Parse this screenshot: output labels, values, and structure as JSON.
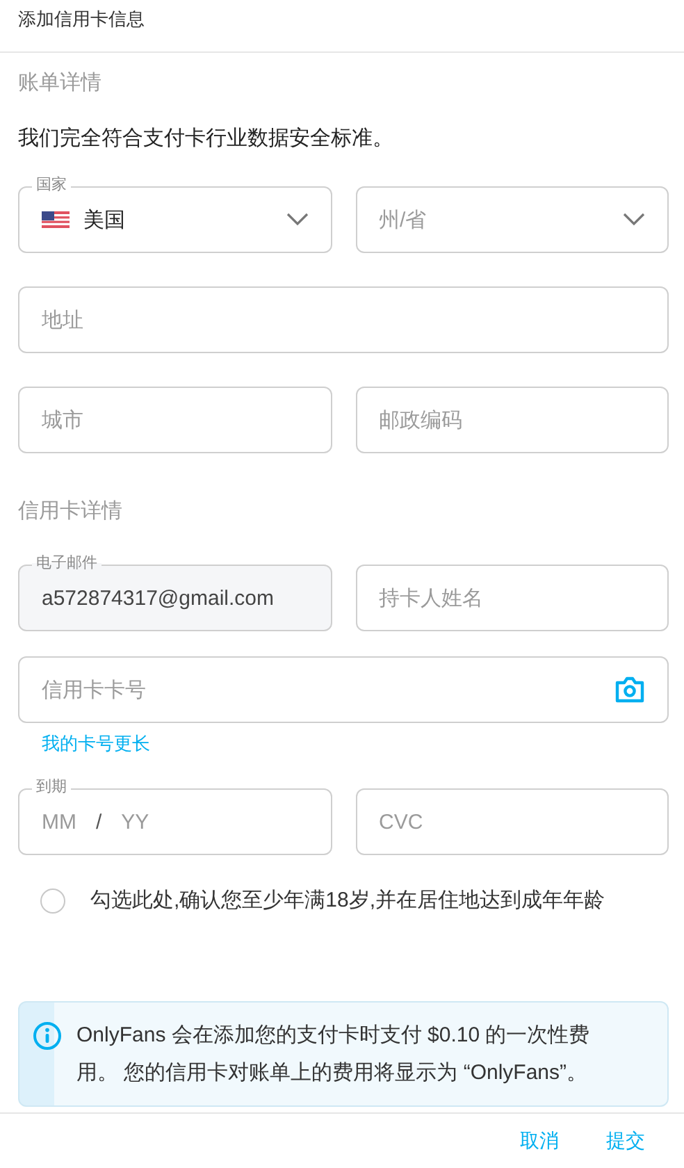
{
  "title": "添加信用卡信息",
  "form": [
    {
      "kind": "heading",
      "text": "账单详情"
    },
    {
      "kind": "note",
      "text": "我们完全符合支付卡行业数据安全标准。"
    },
    {
      "kind": "row",
      "fields": [
        {
          "kind": "country",
          "label": "国家",
          "value": "美国"
        },
        {
          "kind": "select",
          "placeholder": "州/省"
        }
      ]
    },
    {
      "kind": "row",
      "fields": [
        {
          "kind": "text",
          "placeholder": "地址"
        }
      ]
    },
    {
      "kind": "row",
      "fields": [
        {
          "kind": "text",
          "placeholder": "城市"
        },
        {
          "kind": "text",
          "placeholder": "邮政编码"
        }
      ]
    },
    {
      "kind": "heading",
      "text": "信用卡详情"
    },
    {
      "kind": "row",
      "fields": [
        {
          "kind": "text",
          "label": "电子邮件",
          "value": "a572874317@gmail.com",
          "disabled": true
        },
        {
          "kind": "text",
          "placeholder": "持卡人姓名"
        }
      ]
    },
    {
      "kind": "row",
      "fields": [
        {
          "kind": "card",
          "placeholder": "信用卡卡号"
        }
      ]
    },
    {
      "kind": "link",
      "text": "我的卡号更长"
    },
    {
      "kind": "row",
      "fields": [
        {
          "kind": "expiry",
          "label": "到期",
          "month": "MM",
          "separator": "/",
          "year": "YY"
        },
        {
          "kind": "text",
          "placeholder": "CVC"
        }
      ]
    },
    {
      "kind": "checkbox",
      "text": "勾选此处,确认您至少年满18岁,并在居住地达到成年年龄",
      "checked": false
    },
    {
      "kind": "notice",
      "text": "OnlyFans 会在添加您的支付卡时支付 $0.10 的一次性费用。 您的信用卡对账单上的费用将显示为 “OnlyFans”。"
    }
  ],
  "buttons": [
    {
      "label": "取消"
    },
    {
      "label": "提交"
    }
  ]
}
